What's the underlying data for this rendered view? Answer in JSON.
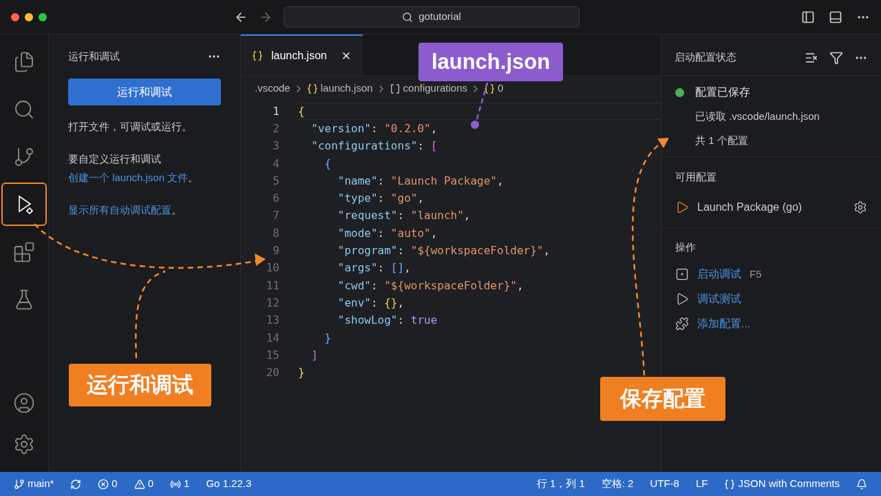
{
  "window": {
    "search": "gotutorial"
  },
  "activity_bar": [
    {
      "kind": "files",
      "selected": false
    },
    {
      "kind": "search",
      "selected": false
    },
    {
      "kind": "source-control",
      "selected": false
    },
    {
      "kind": "run",
      "selected": true
    },
    {
      "kind": "extensions",
      "selected": false
    },
    {
      "kind": "testing",
      "selected": false
    }
  ],
  "activity_bottom": [
    {
      "kind": "account"
    },
    {
      "kind": "settings"
    }
  ],
  "sidebar": {
    "title": "运行和调试",
    "run_button": "运行和调试",
    "paragraphs": [
      {
        "text": "打开文件，可调试或运行。"
      },
      {
        "text": "要自定义运行和调试",
        "link": "创建一个 launch.json 文件",
        "after": "。"
      },
      {
        "link": "显示所有自动调试配置",
        "after": "。"
      }
    ]
  },
  "tabs": [
    {
      "label": "launch.json",
      "selected": true
    }
  ],
  "breadcrumb": [
    {
      "kind": "folder",
      "label": ".vscode"
    },
    {
      "kind": "object",
      "label": "launch.json"
    },
    {
      "kind": "array",
      "label": "configurations"
    },
    {
      "kind": "object",
      "label": "0"
    }
  ],
  "code": [
    {
      "number": "1",
      "current": true,
      "tokens": [
        {
          "kind": "brace1",
          "text": "{"
        }
      ]
    },
    {
      "number": "2",
      "current": false,
      "tokens": [
        {
          "kind": "key",
          "text": "  \"version\""
        },
        {
          "kind": "punct",
          "text": ": "
        },
        {
          "kind": "str",
          "text": "\"0.2.0\""
        },
        {
          "kind": "punct",
          "text": ","
        }
      ]
    },
    {
      "number": "3",
      "current": false,
      "tokens": [
        {
          "kind": "key",
          "text": "  \"configurations\""
        },
        {
          "kind": "punct",
          "text": ": "
        },
        {
          "kind": "bracket",
          "text": "["
        }
      ]
    },
    {
      "number": "4",
      "current": false,
      "tokens": [
        {
          "kind": "brace2",
          "text": "    {"
        }
      ]
    },
    {
      "number": "5",
      "current": false,
      "tokens": [
        {
          "kind": "key",
          "text": "      \"name\""
        },
        {
          "kind": "punct",
          "text": ": "
        },
        {
          "kind": "str",
          "text": "\"Launch Package\""
        },
        {
          "kind": "punct",
          "text": ","
        }
      ]
    },
    {
      "number": "6",
      "current": false,
      "tokens": [
        {
          "kind": "key",
          "text": "      \"type\""
        },
        {
          "kind": "punct",
          "text": ": "
        },
        {
          "kind": "str",
          "text": "\"go\""
        },
        {
          "kind": "punct",
          "text": ","
        }
      ]
    },
    {
      "number": "7",
      "current": false,
      "tokens": [
        {
          "kind": "key",
          "text": "      \"request\""
        },
        {
          "kind": "punct",
          "text": ": "
        },
        {
          "kind": "str",
          "text": "\"launch\""
        },
        {
          "kind": "punct",
          "text": ","
        }
      ]
    },
    {
      "number": "8",
      "current": false,
      "tokens": [
        {
          "kind": "key",
          "text": "      \"mode\""
        },
        {
          "kind": "punct",
          "text": ": "
        },
        {
          "kind": "str",
          "text": "\"auto\""
        },
        {
          "kind": "punct",
          "text": ","
        }
      ]
    },
    {
      "number": "9",
      "current": false,
      "tokens": [
        {
          "kind": "key",
          "text": "      \"program\""
        },
        {
          "kind": "punct",
          "text": ": "
        },
        {
          "kind": "str",
          "text": "\"${workspaceFolder}\""
        },
        {
          "kind": "punct",
          "text": ","
        }
      ]
    },
    {
      "number": "10",
      "current": false,
      "tokens": [
        {
          "kind": "key",
          "text": "      \"args\""
        },
        {
          "kind": "punct",
          "text": ": "
        },
        {
          "kind": "brace2",
          "text": "[]"
        },
        {
          "kind": "punct",
          "text": ","
        }
      ]
    },
    {
      "number": "11",
      "current": false,
      "tokens": [
        {
          "kind": "key",
          "text": "      \"cwd\""
        },
        {
          "kind": "punct",
          "text": ": "
        },
        {
          "kind": "str",
          "text": "\"${workspaceFolder}\""
        },
        {
          "kind": "punct",
          "text": ","
        }
      ]
    },
    {
      "number": "12",
      "current": false,
      "tokens": [
        {
          "kind": "key",
          "text": "      \"env\""
        },
        {
          "kind": "punct",
          "text": ": "
        },
        {
          "kind": "brace1",
          "text": "{}"
        },
        {
          "kind": "punct",
          "text": ","
        }
      ]
    },
    {
      "number": "13",
      "current": false,
      "tokens": [
        {
          "kind": "key",
          "text": "      \"showLog\""
        },
        {
          "kind": "punct",
          "text": ": "
        },
        {
          "kind": "bool",
          "text": "true"
        }
      ]
    },
    {
      "number": "14",
      "current": false,
      "tokens": [
        {
          "kind": "brace2",
          "text": "    }"
        }
      ]
    },
    {
      "number": "15",
      "current": false,
      "tokens": [
        {
          "kind": "bracket",
          "text": "  ]"
        }
      ]
    },
    {
      "number": "20",
      "current": false,
      "tokens": [
        {
          "kind": "brace1",
          "text": "}"
        }
      ]
    }
  ],
  "panel": {
    "title": "启动配置状态",
    "status": {
      "title": "配置已保存",
      "color": "#4caf50",
      "lines": [
        "已读取 .vscode/launch.json",
        "共 1 个配置"
      ]
    },
    "available": {
      "title": "可用配置",
      "items": [
        {
          "label": "Launch Package (go)"
        }
      ]
    },
    "actions": {
      "title": "操作",
      "items": [
        {
          "kind": "start",
          "label": "启动调试",
          "shortcut": "F5"
        },
        {
          "kind": "test",
          "label": "调试测试"
        },
        {
          "kind": "add",
          "label": "添加配置..."
        }
      ]
    }
  },
  "status_bar": {
    "left": [
      {
        "kind": "branch",
        "text": "main*"
      },
      {
        "kind": "sync"
      },
      {
        "kind": "errors",
        "text": "0"
      },
      {
        "kind": "warnings",
        "text": "0"
      },
      {
        "kind": "ports",
        "text": "1"
      },
      {
        "kind": "plain",
        "text": "Go 1.22.3"
      }
    ],
    "right": [
      {
        "kind": "plain",
        "text": "行 1，列 1"
      },
      {
        "kind": "plain",
        "text": "空格: 2"
      },
      {
        "kind": "plain",
        "text": "UTF-8"
      },
      {
        "kind": "plain",
        "text": "LF"
      },
      {
        "kind": "braces",
        "text": "JSON with Comments"
      },
      {
        "kind": "bell"
      }
    ]
  },
  "callouts": [
    {
      "text": "launch.json",
      "color": "#8c5ccf"
    },
    {
      "text": "运行和调试",
      "color": "#f07f22"
    },
    {
      "text": "保存配置",
      "color": "#f07f22"
    }
  ]
}
